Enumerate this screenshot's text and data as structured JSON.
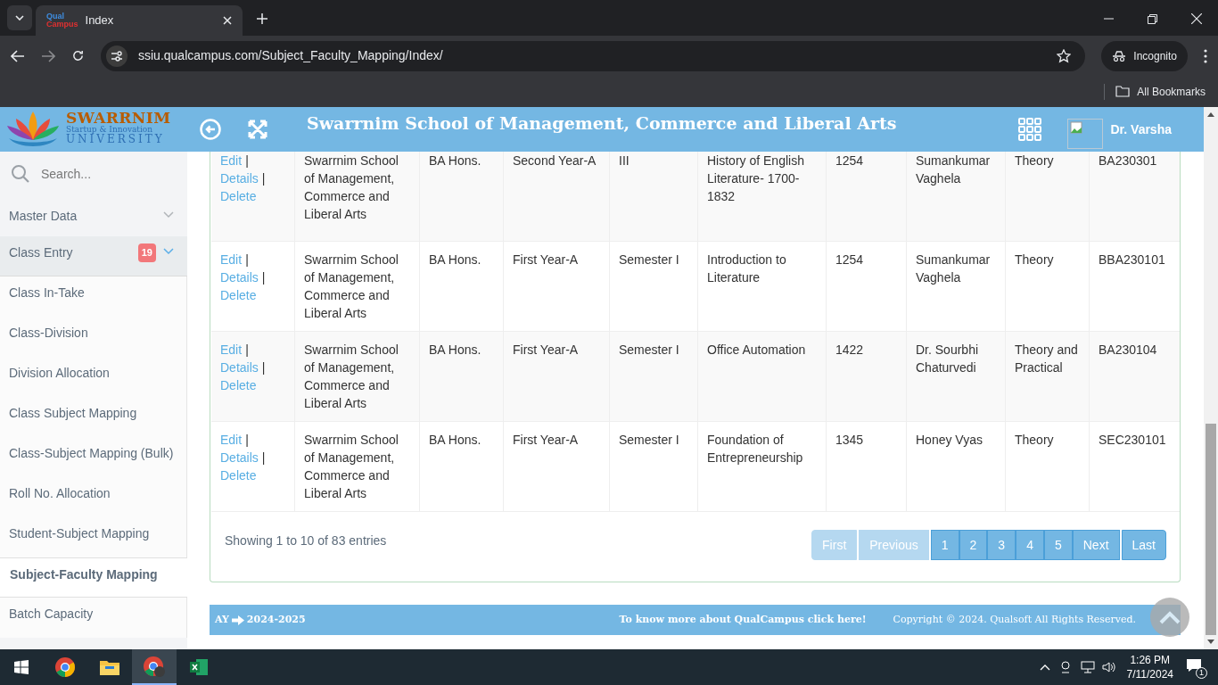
{
  "browser": {
    "tab_title": "Index",
    "favicon": [
      "Qual",
      "Campus"
    ],
    "url": "ssiu.qualcampus.com/Subject_Faculty_Mapping/Index/",
    "incognito": "Incognito",
    "bookmarks": "All Bookmarks"
  },
  "header": {
    "logo": {
      "name": "SWARRNIM",
      "line": "Startup & Innovation",
      "sub": "UNIVERSITY"
    },
    "title": "Swarrnim School of Management, Commerce and Liberal Arts",
    "user": "Dr. Varsha"
  },
  "sidebar": {
    "search_placeholder": "Search...",
    "items": [
      {
        "label": "Master Data",
        "kind": "group",
        "expanded": false
      },
      {
        "label": "Class Entry",
        "kind": "group",
        "expanded": true,
        "badge": "19"
      },
      {
        "label": "Class In-Take",
        "kind": "link",
        "selected": false
      },
      {
        "label": "Class-Division",
        "kind": "link",
        "selected": false
      },
      {
        "label": "Division Allocation",
        "kind": "link",
        "selected": false
      },
      {
        "label": "Class Subject Mapping",
        "kind": "link",
        "selected": false
      },
      {
        "label": "Class-Subject Mapping (Bulk)",
        "kind": "link",
        "selected": false
      },
      {
        "label": "Roll No. Allocation",
        "kind": "link",
        "selected": false
      },
      {
        "label": "Student-Subject Mapping",
        "kind": "link",
        "selected": false
      },
      {
        "label": "Subject-Faculty Mapping",
        "kind": "link",
        "selected": true
      },
      {
        "label": "Batch Capacity",
        "kind": "link",
        "selected": false
      }
    ]
  },
  "table": {
    "rows": [
      {
        "actions": [
          "Edit",
          "Details",
          "Delete"
        ],
        "cells": [
          "Swarrnim School of Management, Commerce and Liberal Arts",
          "BA Hons.",
          "Second Year-A",
          "III",
          "History of English Literature- 1700-1832",
          "1254",
          "Sumankumar Vaghela",
          "Theory",
          "BA230301"
        ]
      },
      {
        "actions": [
          "Edit",
          "Details",
          "Delete"
        ],
        "cells": [
          "Swarrnim School of Management, Commerce and Liberal Arts",
          "BA Hons.",
          "First Year-A",
          "Semester I",
          "Introduction to Literature",
          "1254",
          "Sumankumar Vaghela",
          "Theory",
          "BBA230101"
        ]
      },
      {
        "actions": [
          "Edit",
          "Details",
          "Delete"
        ],
        "cells": [
          "Swarrnim School of Management, Commerce and Liberal Arts",
          "BA Hons.",
          "First Year-A",
          "Semester I",
          "Office Automation",
          "1422",
          "Dr. Sourbhi Chaturvedi",
          "Theory and Practical",
          "BA230104"
        ]
      },
      {
        "actions": [
          "Edit",
          "Details",
          "Delete"
        ],
        "cells": [
          "Swarrnim School of Management, Commerce and Liberal Arts",
          "BA Hons.",
          "First Year-A",
          "Semester I",
          "Foundation of Entrepreneurship",
          "1345",
          "Honey Vyas",
          "Theory",
          "SEC230101"
        ]
      }
    ],
    "separator": "|",
    "info": "Showing 1 to 10 of 83 entries",
    "pagination": [
      {
        "label": "First",
        "disabled": true
      },
      {
        "label": "Previous",
        "disabled": true
      },
      {
        "label": "1",
        "disabled": false
      },
      {
        "label": "2",
        "disabled": false
      },
      {
        "label": "3",
        "disabled": false
      },
      {
        "label": "4",
        "disabled": false
      },
      {
        "label": "5",
        "disabled": false
      },
      {
        "label": "Next",
        "disabled": false
      },
      {
        "label": "Last",
        "disabled": false
      }
    ]
  },
  "footer": {
    "ay": "AY",
    "year": "2024-2025",
    "link": "To know more about QualCampus click here!",
    "copyright": "Copyright © 2024. Qualsoft All Rights Reserved."
  },
  "taskbar": {
    "time": "1:26 PM",
    "date": "7/11/2024",
    "notifications": "1"
  }
}
